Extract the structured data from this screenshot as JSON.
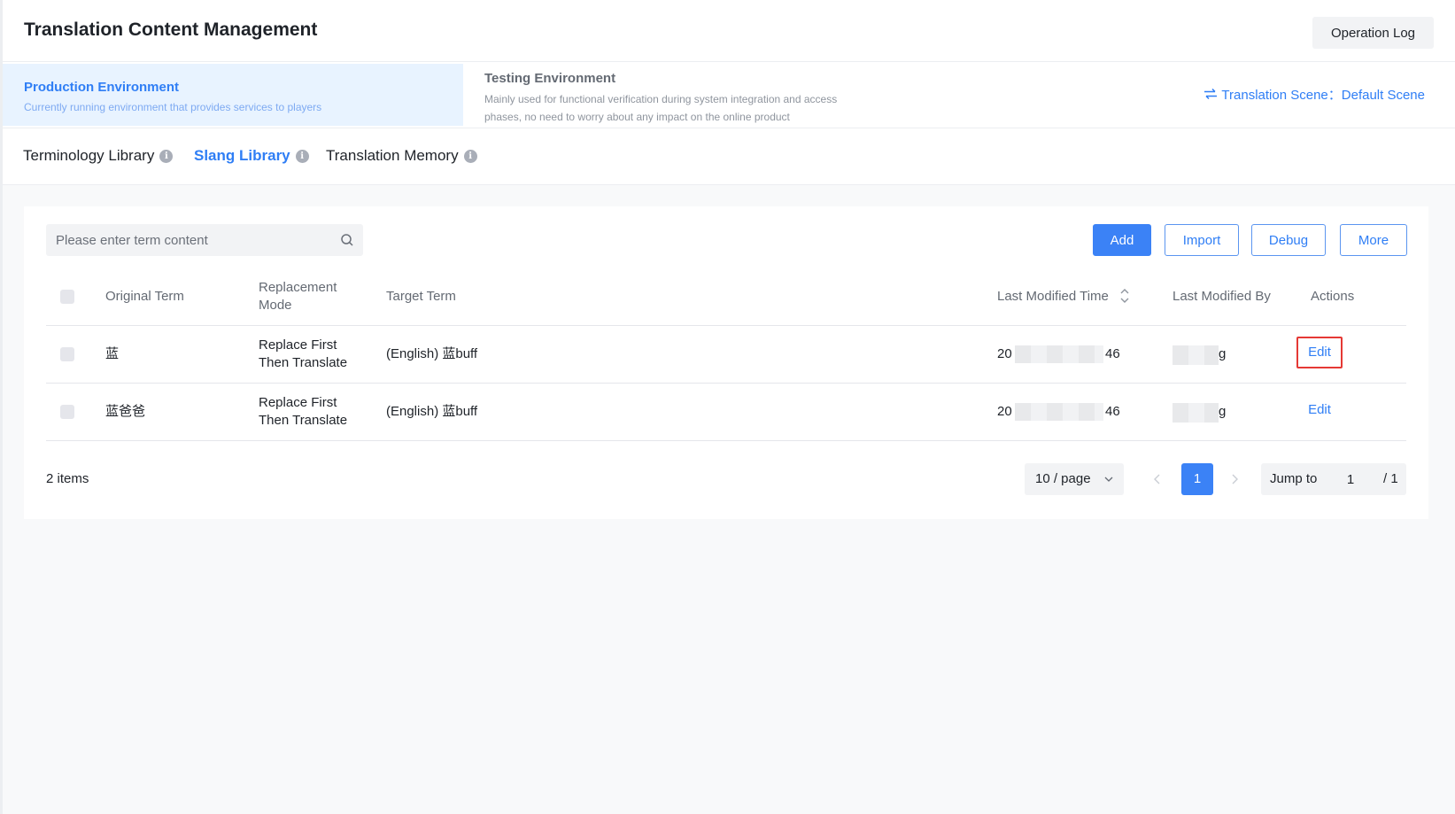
{
  "header": {
    "title": "Translation Content Management",
    "operation_log_label": "Operation Log"
  },
  "environments": {
    "production": {
      "title": "Production Environment",
      "description": "Currently running environment that provides services to players",
      "selected": true
    },
    "testing": {
      "title": "Testing Environment",
      "description": "Mainly used for functional verification during system integration and access phases, no need to worry about any impact on the online product",
      "selected": false
    }
  },
  "scene": {
    "icon": "swap-icon",
    "label": "Translation Scene：",
    "value": "Default Scene"
  },
  "library_tabs": [
    {
      "label": "Terminology Library",
      "active": false
    },
    {
      "label": "Slang Library",
      "active": true
    },
    {
      "label": "Translation Memory",
      "active": false
    }
  ],
  "toolbar": {
    "search_placeholder": "Please enter term content",
    "add_label": "Add",
    "import_label": "Import",
    "debug_label": "Debug",
    "more_label": "More"
  },
  "table": {
    "columns": {
      "original_term": "Original Term",
      "replacement_mode": "Replacement Mode",
      "target_term": "Target Term",
      "last_modified_time": "Last Modified Time",
      "last_modified_by": "Last Modified By",
      "actions": "Actions"
    },
    "rows": [
      {
        "original_term": "蓝",
        "replacement_mode": "Replace First Then Translate",
        "target_term": "(English) 蓝buff",
        "time_prefix": "20",
        "time_suffix": "46",
        "modified_by_suffix": "g",
        "action": "Edit",
        "highlighted": true
      },
      {
        "original_term": "蓝爸爸",
        "replacement_mode": "Replace First Then Translate",
        "target_term": "(English) 蓝buff",
        "time_prefix": "20",
        "time_suffix": "46",
        "modified_by_suffix": "g",
        "action": "Edit",
        "highlighted": false
      }
    ]
  },
  "pagination": {
    "total_label": "2 items",
    "page_size_label": "10 / page",
    "current_page": "1",
    "jump_label": "Jump to",
    "jump_value": "1",
    "total_pages_label": "/ 1"
  },
  "colors": {
    "accent": "#2f7ef5",
    "primary_button": "#3b82f6",
    "highlight_border": "#e53935"
  }
}
